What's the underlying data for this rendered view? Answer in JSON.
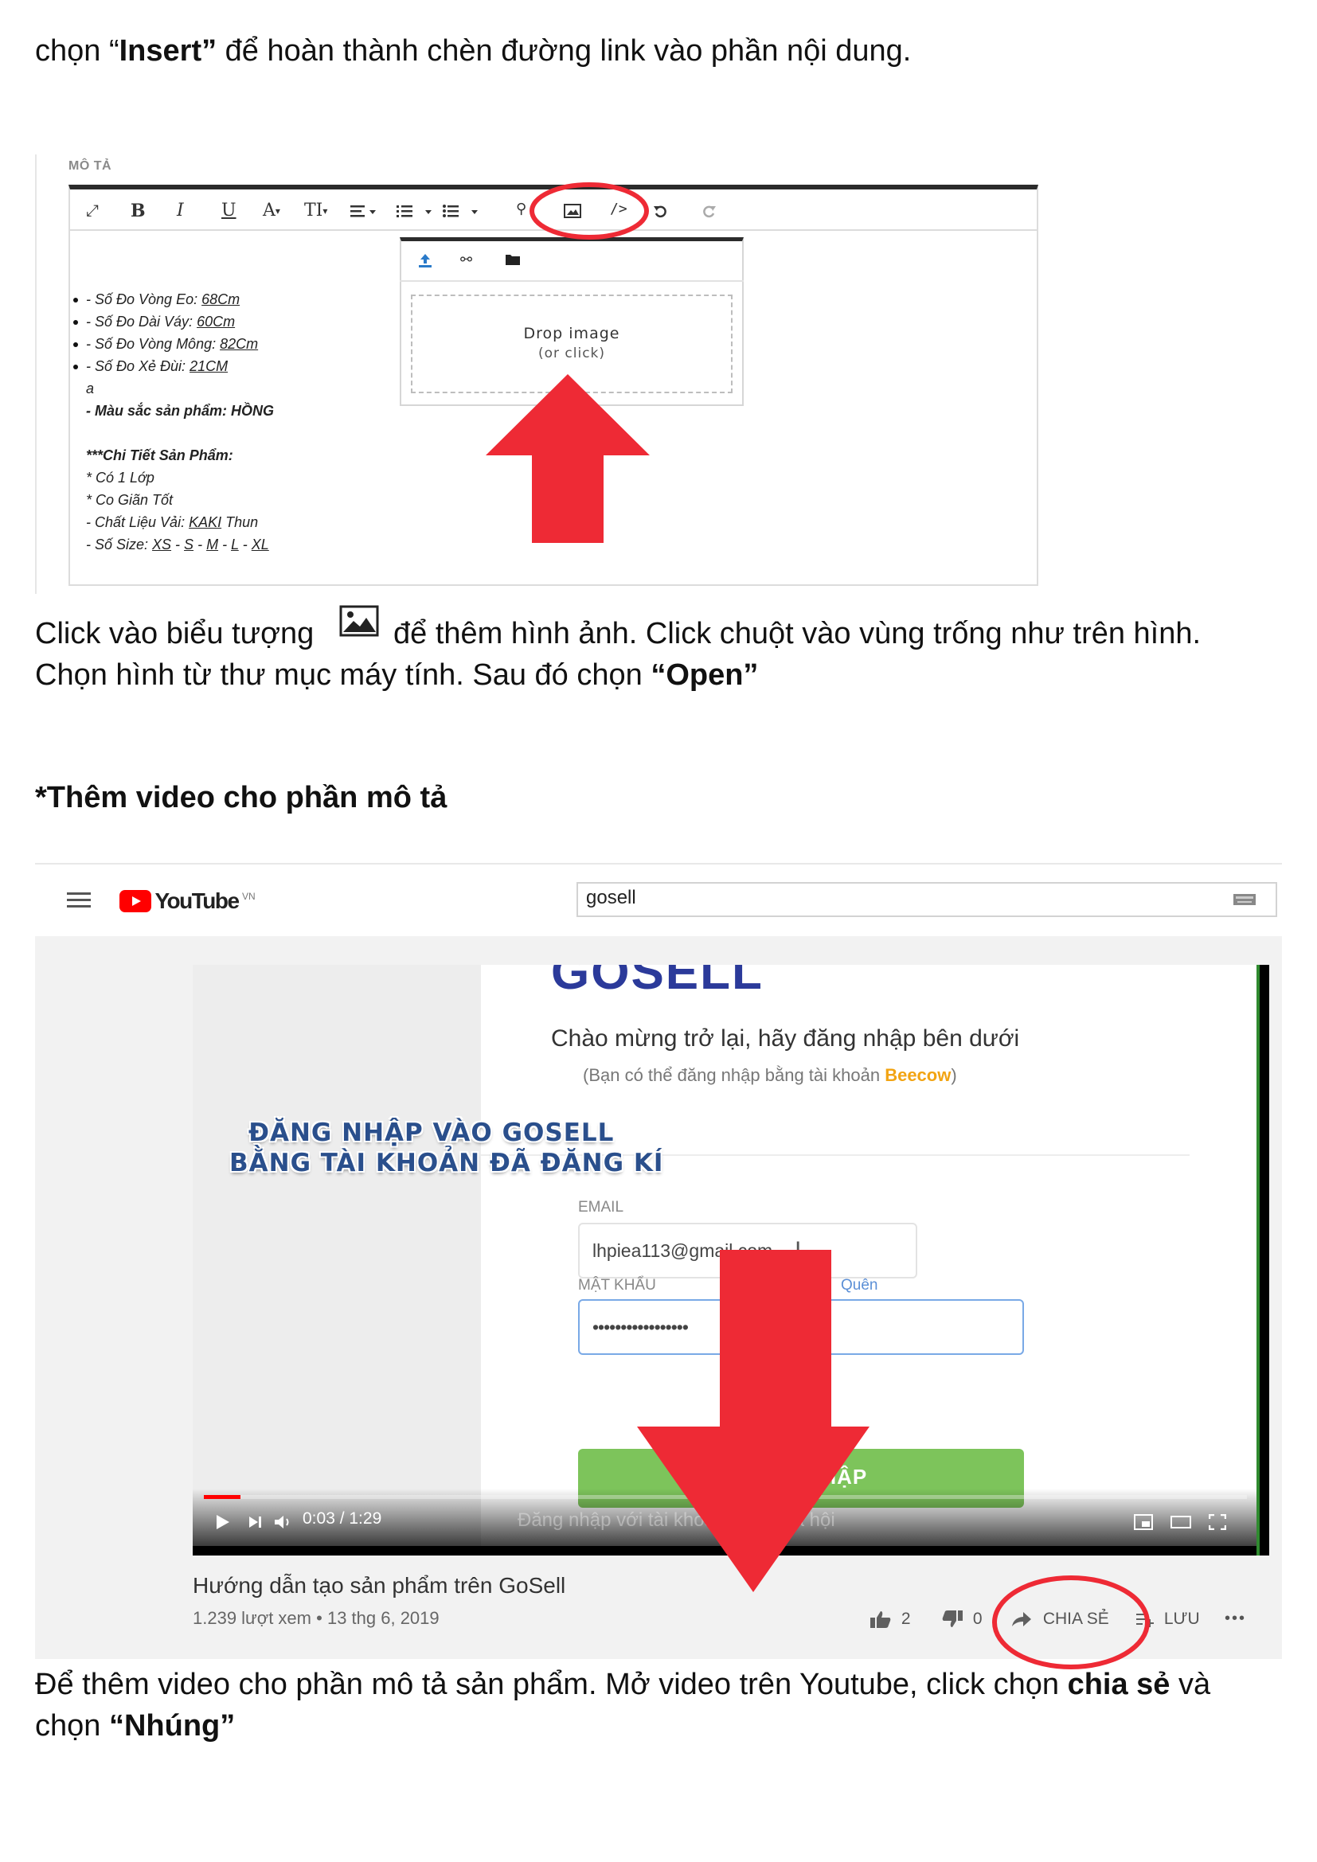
{
  "intro": {
    "pre": "chọn “",
    "bold": "Insert”",
    "post": "  để hoàn thành chèn đường link vào phần nội dung."
  },
  "editor": {
    "field_label": "MÔ TẢ",
    "toolbar": {
      "bold": "B",
      "italic": "I",
      "underline": "U",
      "font_color": "A",
      "font_size": "TI",
      "caret": "▾"
    },
    "content": {
      "bullets": [
        {
          "pre": "- Số Đo Vòng Eo: ",
          "u": "68Cm"
        },
        {
          "pre": "- Số Đo Dài Váy: ",
          "u": "60Cm"
        },
        {
          "pre": "- Số Đo Vòng Mông: ",
          "u": "82Cm"
        },
        {
          "pre": "- Số Đo Xẻ Đùi: ",
          "u": "21CM"
        }
      ],
      "stray": "a",
      "color_line": "- Màu sắc sản phẩm: HỒNG",
      "details_heading": "***Chi Tiết Sản Phẩm:",
      "detail_1": "* Có 1 Lớp",
      "detail_2": "* Co Giãn Tốt",
      "material": {
        "pre": "- Chất Liệu Vải: ",
        "u": "KAKI",
        "post": " Thun"
      },
      "sizes": {
        "pre": "- Số Size: ",
        "values": [
          "XS",
          "S",
          "M",
          "L",
          "XL"
        ],
        "sep": " - "
      }
    },
    "image_popup": {
      "drop_title": "Drop image",
      "drop_sub": "(or click)"
    }
  },
  "step_image": {
    "line1_pre": "Click vào biểu tượng",
    "line1_post": "để thêm hình ảnh. Click chuột vào vùng trống như trên hình.",
    "line2_pre": "Chọn hình từ thư mục máy tính. Sau đó chọn ",
    "line2_bold": "“Open”"
  },
  "video_heading": "*Thêm video cho phần mô tả",
  "youtube": {
    "logo_text": "YouTube",
    "region": "VN",
    "search_value": "gosell",
    "video": {
      "brand": "GOSELL",
      "greeting": "Chào mừng trở lại, hãy đăng nhập bên dưới",
      "sub_pre": "(Bạn có thể đăng nhập bằng tài khoản ",
      "sub_brand": "Beecow",
      "sub_post": ")",
      "caption_line1": "ĐĂNG NHẬP VÀO GOSELL",
      "caption_line2": "BẰNG TÀI KHOẢN ĐÃ ĐĂNG KÍ",
      "email_label": "EMAIL",
      "email_value": "lhpiea113@gmail.com",
      "password_label": "MẬT KHẨU",
      "forgot_partial": "Quên",
      "password_value": "•••••••••••••••••",
      "login_button": "ĐĂNG NHẬP",
      "social_hint": "Đăng nhập với tài khoản mạng xã hội",
      "time": "0:03 / 1:29",
      "progress": 0.035
    },
    "title": "Hướng dẫn tạo sản phẩm trên GoSell",
    "views": "1.239 lượt xem",
    "dot": "•",
    "date": "13 thg 6, 2019",
    "likes": "2",
    "dislikes": "0",
    "share": "CHIA SẺ",
    "save": "LƯU",
    "more": "•••"
  },
  "step_video": {
    "line1_pre": "Để thêm video cho phần mô tả sản phẩm. Mở video trên Youtube, click chọn ",
    "line1_bold": "chia sẻ",
    "line1_post": " và",
    "line2_pre": "chọn ",
    "line2_bold": "“Nhúng”"
  },
  "colors": {
    "annotation_red": "#ee2a35",
    "youtube_red": "#ff0000",
    "login_green": "#7dc45b",
    "beecow_orange": "#f2a413"
  }
}
